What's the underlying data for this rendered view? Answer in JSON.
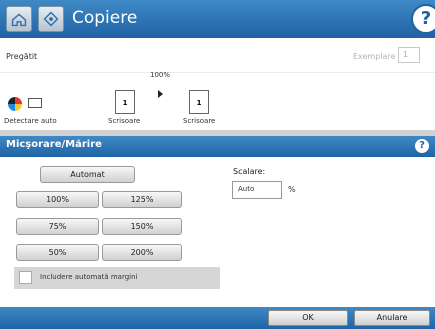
{
  "header": {
    "title": "Copiere",
    "help": "?"
  },
  "status": {
    "ready": "Pregătit",
    "copies_label": "Exemplare",
    "copies_value": "1"
  },
  "preview": {
    "scale": "100%",
    "source_number": "1",
    "dest_number": "1",
    "source_label": "Scrisoare",
    "dest_label": "Scrisoare",
    "detect_label": "Detectare auto"
  },
  "panel": {
    "title": "Micşorare/Mărire",
    "help": "?",
    "auto_button": "Automat",
    "presets": [
      "100%",
      "125%",
      "75%",
      "150%",
      "50%",
      "200%"
    ],
    "scale_label": "Scalare:",
    "scale_value": "Auto",
    "percent_symbol": "%",
    "auto_margin_label": "Includere automată margini",
    "auto_margin_checked": false
  },
  "footer": {
    "ok": "OK",
    "cancel": "Anulare"
  },
  "colors": {
    "header": "#2f75b6",
    "panel_bg": "#ffffff"
  }
}
